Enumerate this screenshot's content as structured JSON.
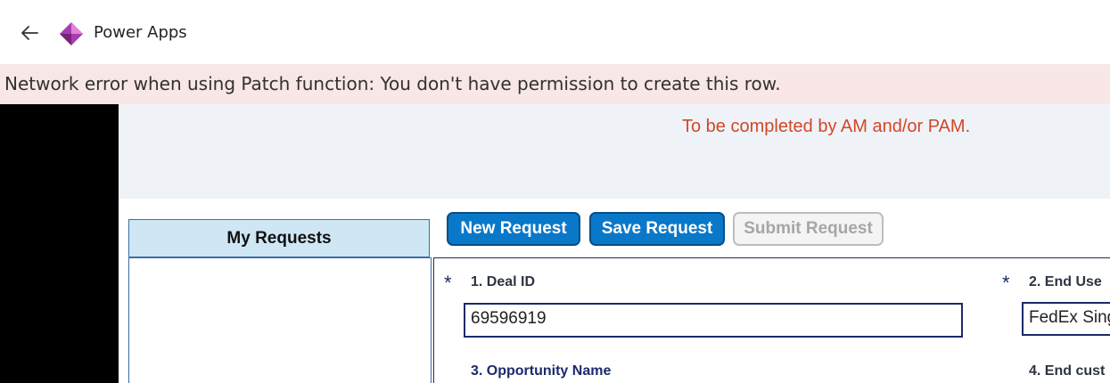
{
  "app": {
    "title": "Power Apps"
  },
  "error_banner": {
    "message": "Network error when using Patch function: You don't have permission to create this row."
  },
  "header": {
    "notice": "To be completed by AM and/or PAM."
  },
  "requests_panel": {
    "title": "My Requests"
  },
  "toolbar": {
    "new_label": "New Request",
    "save_label": "Save Request",
    "submit_label": "Submit Request"
  },
  "form": {
    "fields": [
      {
        "label": "1. Deal ID",
        "value": "69596919",
        "required": true
      },
      {
        "label": "2. End Use",
        "value": "FedEx Sing",
        "required": true
      },
      {
        "label": "3. Opportunity Name",
        "value": "",
        "required": false
      },
      {
        "label": "4. End cust",
        "value": "",
        "required": false
      }
    ]
  },
  "colors": {
    "error_background": "#f9e6e6",
    "notice_text": "#d24726",
    "primary_button": "#0a78c9",
    "panel_background": "#eff3f8",
    "requests_header": "#cfe6f5"
  },
  "icons": {
    "back": "arrow-left-icon",
    "logo": "power-apps-logo"
  }
}
